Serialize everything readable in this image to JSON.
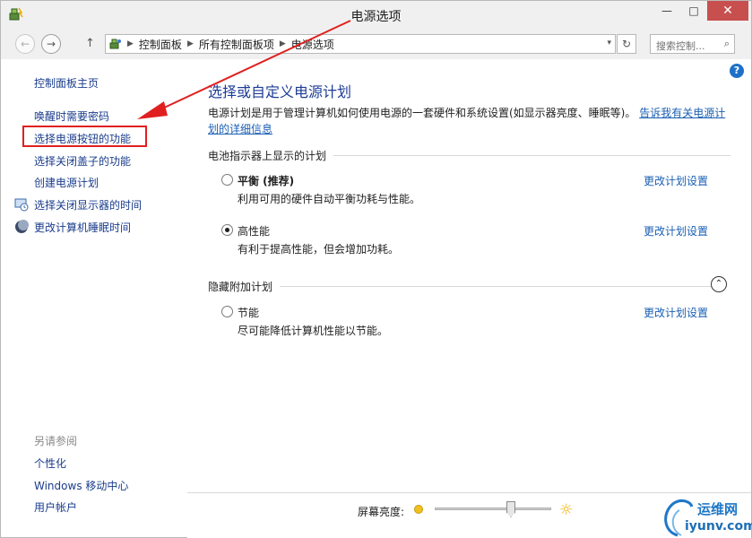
{
  "window": {
    "title": "电源选项",
    "min_glyph": "—",
    "max_glyph": "□",
    "close_glyph": "✕"
  },
  "nav": {
    "back_glyph": "←",
    "forward_glyph": "→",
    "up_glyph": "↑",
    "breadcrumbs": [
      "控制面板",
      "所有控制面板项",
      "电源选项"
    ],
    "crumb_sep": "▶",
    "dropdown_glyph": "▾",
    "refresh_glyph": "↻",
    "search_placeholder": "搜索控制...",
    "search_glyph": "⌕",
    "help_glyph": "?"
  },
  "sidebar": {
    "home": "控制面板主页",
    "links": [
      "唤醒时需要密码",
      "选择电源按钮的功能",
      "选择关闭盖子的功能",
      "创建电源计划",
      "选择关闭显示器的时间",
      "更改计算机睡眠时间"
    ],
    "see_also_title": "另请参阅",
    "see_also": [
      "个性化",
      "Windows 移动中心",
      "用户帐户"
    ]
  },
  "main": {
    "title": "选择或自定义电源计划",
    "description": "电源计划是用于管理计算机如何使用电源的一套硬件和系统设置(如显示器亮度、睡眠等)。",
    "description_link": "告诉我有关电源计划的详细信息",
    "group_shown": "电池指示器上显示的计划",
    "group_hidden": "隐藏附加计划",
    "collapse_glyph": "⌃",
    "change_link": "更改计划设置",
    "plans": [
      {
        "name": "平衡 (推荐)",
        "desc": "利用可用的硬件自动平衡功耗与性能。",
        "selected": false
      },
      {
        "name": "高性能",
        "desc": "有利于提高性能，但会增加功耗。",
        "selected": true
      },
      {
        "name": "节能",
        "desc": "尽可能降低计算机性能以节能。",
        "selected": false
      }
    ]
  },
  "brightness": {
    "label": "屏幕亮度:",
    "level_fraction": 0.65,
    "sun_glyph": "☼"
  },
  "watermark": {
    "line1": "运维网",
    "line2": "iyunv.com"
  },
  "colors": {
    "link": "#1a3c8c",
    "title_blue": "#1e3c96",
    "annotation_red": "#e02020",
    "close_red": "#c7504e"
  }
}
